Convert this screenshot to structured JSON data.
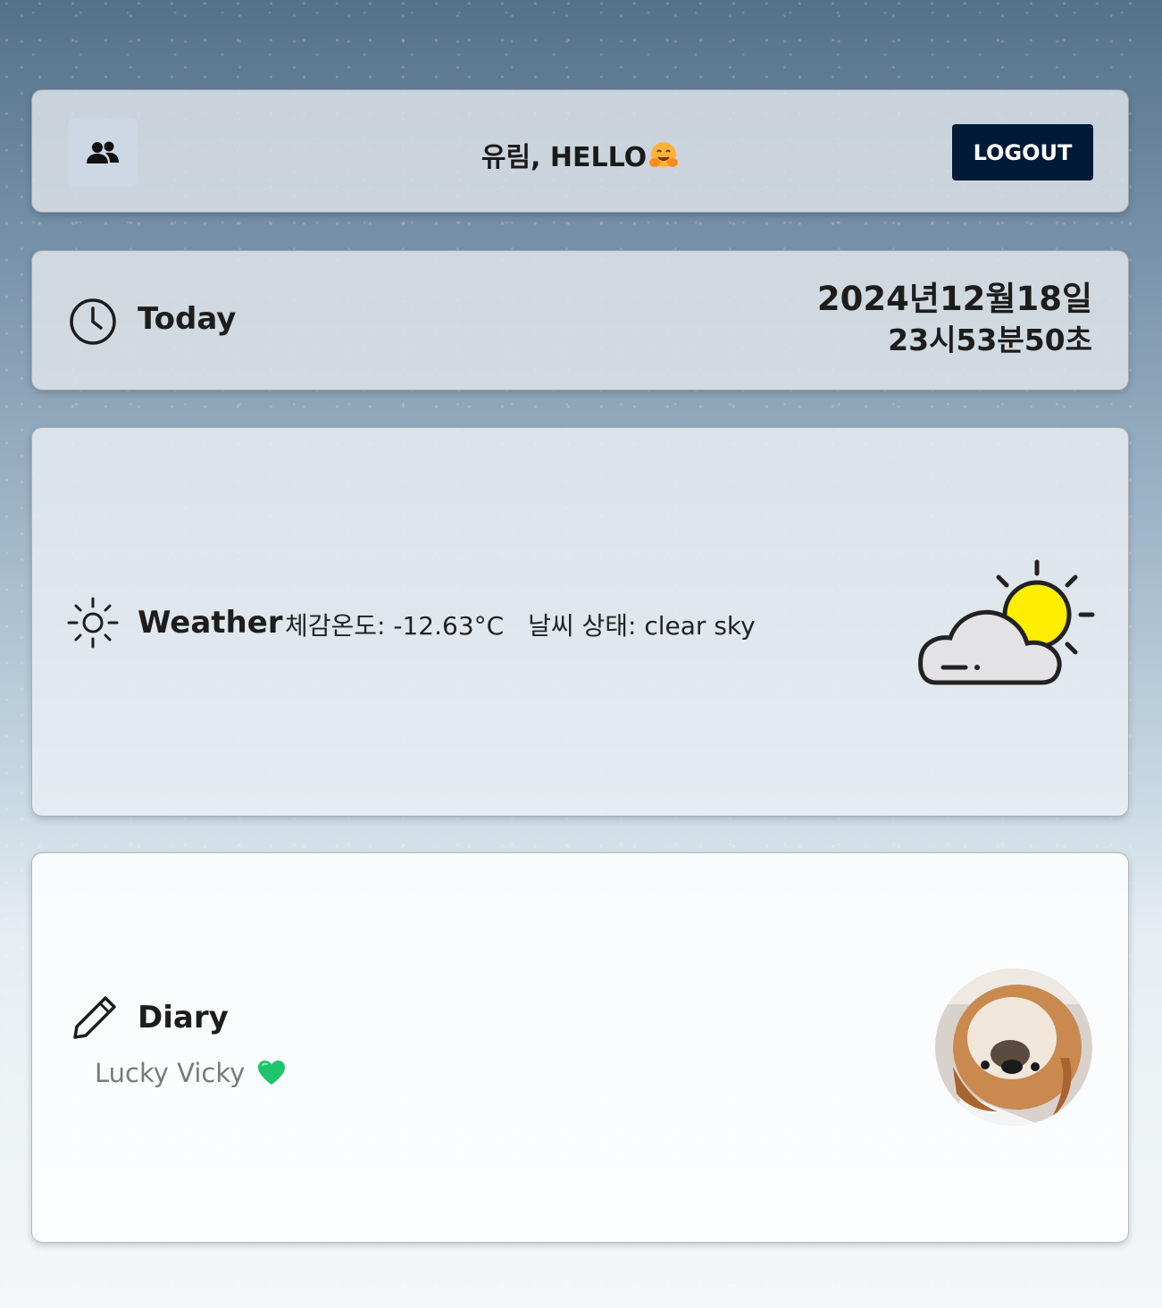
{
  "header": {
    "user_icon": "users-icon",
    "greeting": "유림, HELLO",
    "greeting_emoji": "hugging-face-icon",
    "logout_label": "LOGOUT"
  },
  "today": {
    "icon": "clock-icon",
    "title": "Today",
    "date": "2024년12월18일",
    "time": "23시53분50초"
  },
  "weather": {
    "icon": "sun-icon",
    "title": "Weather",
    "feels_like": "체감온도: -12.63°C",
    "condition": "날씨 상태: clear sky",
    "illustration": "partly-cloudy-icon"
  },
  "diary": {
    "icon": "pencil-icon",
    "title": "Diary",
    "subtitle": "Lucky Vicky",
    "heart_icon": "green-heart-icon",
    "avatar": "dog-avatar"
  },
  "colors": {
    "logout_bg": "#011a35",
    "user_btn_bg": "#cdd8e4",
    "sun": "#ffee00",
    "heart": "#1fc46b"
  }
}
